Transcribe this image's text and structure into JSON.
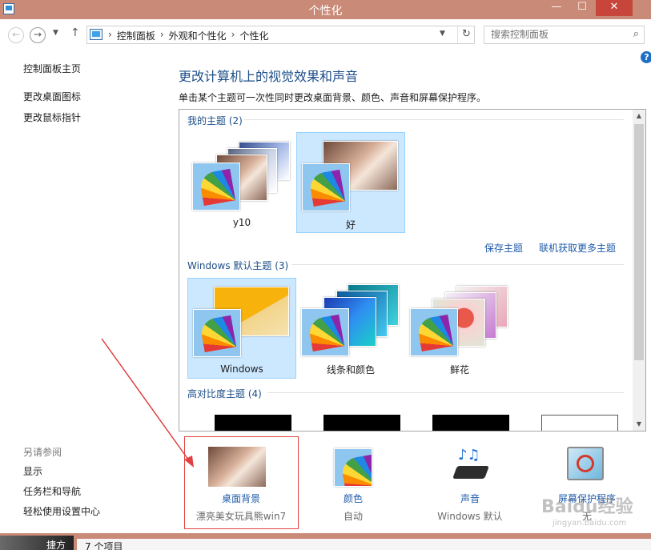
{
  "window": {
    "title": "个性化",
    "minimize": "—",
    "maximize": "☐",
    "close": "✕"
  },
  "address": {
    "crumbs": [
      "控制面板",
      "外观和个性化",
      "个性化"
    ],
    "search_placeholder": "搜索控制面板"
  },
  "sidebar": {
    "links": [
      "控制面板主页",
      "更改桌面图标",
      "更改鼠标指针"
    ],
    "see_also_title": "另请参阅",
    "see_also_links": [
      "显示",
      "任务栏和导航",
      "轻松使用设置中心"
    ]
  },
  "main": {
    "heading": "更改计算机上的视觉效果和声音",
    "subheading": "单击某个主题可一次性同时更改桌面背景、颜色、声音和屏幕保护程序。",
    "groups": [
      {
        "title": "我的主题 (2)",
        "themes": [
          {
            "name": "y10",
            "selected": false
          },
          {
            "name": "好",
            "selected": true
          }
        ]
      },
      {
        "title": "Windows 默认主题 (3)",
        "themes": [
          {
            "name": "Windows",
            "selected": true
          },
          {
            "name": "线条和颜色",
            "selected": false
          },
          {
            "name": "鲜花",
            "selected": false
          }
        ]
      },
      {
        "title": "高对比度主题 (4)"
      }
    ],
    "save_theme": "保存主题",
    "get_more": "联机获取更多主题"
  },
  "bottom": [
    {
      "label": "桌面背景",
      "value": "漂亮美女玩具熊win7"
    },
    {
      "label": "颜色",
      "value": "自动"
    },
    {
      "label": "声音",
      "value": "Windows 默认"
    },
    {
      "label": "屏幕保护程序",
      "value": "无"
    }
  ],
  "status": {
    "items": "7 个项目",
    "shortcut": "捷方"
  },
  "watermark": {
    "main": "Baidu经验",
    "sub": "jingyan.baidu.com"
  },
  "colors": {
    "titlebar": "#c98a77",
    "link": "#1f5ba8",
    "heading": "#1d4e89",
    "selected": "#cce8ff",
    "annotation": "#e04040"
  }
}
